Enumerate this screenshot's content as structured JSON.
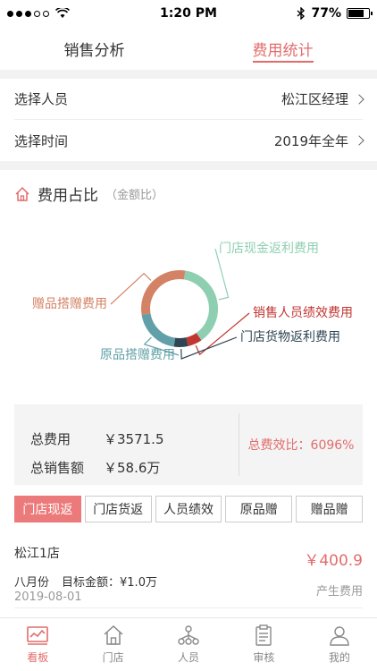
{
  "status": {
    "time": "1:20 PM",
    "battery": "77%",
    "battery_level": 0.77
  },
  "tabs": [
    {
      "label": "销售分析",
      "active": false
    },
    {
      "label": "费用统计",
      "active": true
    }
  ],
  "filters": {
    "person_label": "选择人员",
    "person_value": "松江区经理",
    "time_label": "选择时间",
    "time_value": "2019年全年"
  },
  "section": {
    "title": "费用占比",
    "subtitle": "（金额比）"
  },
  "chart_data": {
    "type": "pie",
    "donut": true,
    "slices": [
      {
        "name": "门店现金返利费用",
        "share": 0.38,
        "color": "#8ecfb2"
      },
      {
        "name": "销售人员绩效费用",
        "share": 0.06,
        "color": "#c23531"
      },
      {
        "name": "门店货物返利费用",
        "share": 0.06,
        "color": "#2f4554"
      },
      {
        "name": "原品搭赠费用",
        "share": 0.2,
        "color": "#61a0a8"
      },
      {
        "name": "赠品搭赠费用",
        "share": 0.3,
        "color": "#d48265"
      }
    ]
  },
  "summary": {
    "total_label": "总费用",
    "total_value": "￥3571.5",
    "sales_label": "总销售额",
    "sales_value": "￥58.6万",
    "ratio": "总费效比：6096%"
  },
  "chips": [
    "门店现返",
    "门店货返",
    "人员绩效",
    "原品赠",
    "赠品赠"
  ],
  "store": {
    "name": "松江1店",
    "amount": "￥400.9",
    "month": "八月份",
    "target": "目标金额：¥1.0万",
    "date": "2019-08-01",
    "note": "产生费用"
  },
  "bottom_tabs": [
    {
      "label": "看板",
      "icon": "dashboard-icon",
      "active": true
    },
    {
      "label": "门店",
      "icon": "home-icon",
      "active": false
    },
    {
      "label": "人员",
      "icon": "people-icon",
      "active": false
    },
    {
      "label": "审核",
      "icon": "clipboard-icon",
      "active": false
    },
    {
      "label": "我的",
      "icon": "user-icon",
      "active": false
    }
  ]
}
